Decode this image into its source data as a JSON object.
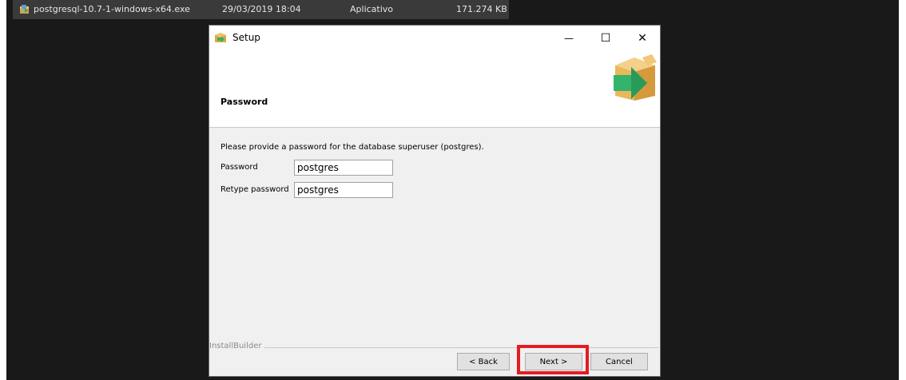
{
  "file_row": {
    "name": "postgresql-10.7-1-windows-x64.exe",
    "date": "29/03/2019 18:04",
    "type": "Aplicativo",
    "size": "171.274 KB",
    "icon": "installer-file-icon"
  },
  "window": {
    "title": "Setup",
    "minimize_glyph": "—",
    "maximize_glyph": "☐",
    "close_glyph": "✕"
  },
  "header": {
    "title": "Password",
    "logo_icon": "box-arrow-icon"
  },
  "content": {
    "prompt": "Please provide a password for the database superuser (postgres).",
    "password_label": "Password",
    "password_value": "postgres",
    "retype_label": "Retype password",
    "retype_value": "postgres"
  },
  "footer": {
    "brand": "InstallBuilder",
    "back_label": "< Back",
    "next_label": "Next >",
    "cancel_label": "Cancel"
  },
  "colors": {
    "highlight": "#e31b23",
    "explorer_background": "#191919",
    "selected_row": "#3a3a3a",
    "window_background": "#f0f0f0"
  }
}
